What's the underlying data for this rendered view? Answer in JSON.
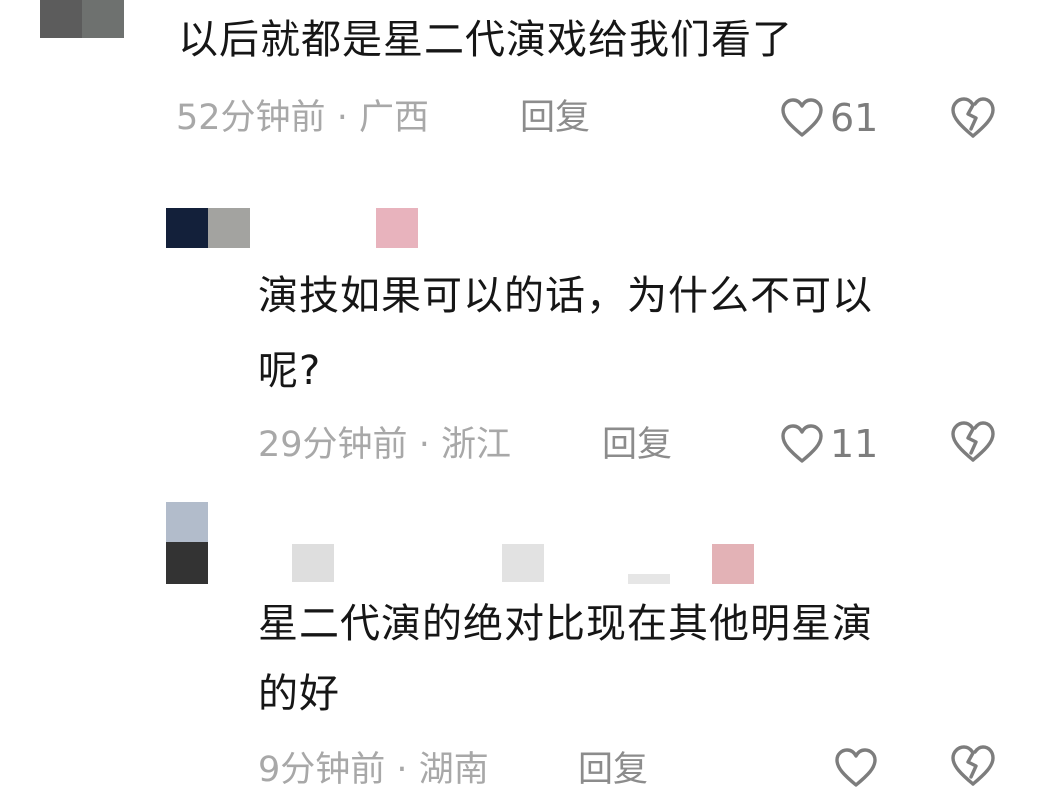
{
  "comments": [
    {
      "text": "以后就都是星二代演戏给我们看了",
      "time": "52分钟前",
      "dot": "·",
      "location": "广西",
      "reply_label": "回复",
      "likes": "61"
    },
    {
      "text_line1": "演技如果可以的话，为什么不可以",
      "text_line2": "呢?",
      "time": "29分钟前",
      "dot": "·",
      "location": "浙江",
      "reply_label": "回复",
      "likes": "11"
    },
    {
      "text_line1": "星二代演的绝对比现在其他明星演",
      "text_line2": "的好",
      "time": "9分钟前",
      "dot": "·",
      "location": "湖南",
      "reply_label": "回复",
      "likes": ""
    }
  ],
  "icons": {
    "like": "heart-outline-icon",
    "dislike": "broken-heart-icon"
  },
  "colors": {
    "text": "#161616",
    "meta": "#a8a8a8",
    "icon": "#7d7d7d"
  }
}
